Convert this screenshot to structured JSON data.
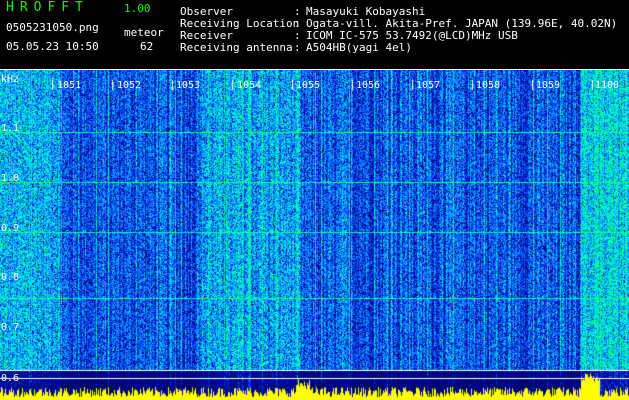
{
  "app": {
    "title": "HROFFT",
    "version": "1.00"
  },
  "left_info": {
    "filename": "0505231050.png",
    "meteor_label": "meteor",
    "datetime": "05.05.23 10:50",
    "meteor_count": "62"
  },
  "info": [
    {
      "label": "Observer",
      "sep": ":",
      "value": "Masayuki Kobayashi"
    },
    {
      "label": "Receiving Location",
      "sep": ":",
      "value": "Ogata-vill. Akita-Pref. JAPAN (139.96E, 40.02N)"
    },
    {
      "label": "Receiver",
      "sep": ":",
      "value": "ICOM IC-575 53.7492(@LCD)MHz USB"
    },
    {
      "label": "Receiving antenna",
      "sep": ":",
      "value": "A504HB(yagi 4el)"
    }
  ],
  "spectrogram": {
    "y_unit": "kHz",
    "y_ticks": [
      "1.1",
      "1.0",
      "0.9",
      "0.8",
      "0.7",
      "0.6"
    ],
    "x_ticks": [
      "1051",
      "1052",
      "1053",
      "1054",
      "1055",
      "1056",
      "1057",
      "1058",
      "1059",
      "1100"
    ],
    "colors": {
      "background": "#000000",
      "low": "#001a8c",
      "mid": "#1a5cff",
      "high": "#00ffcc",
      "peak": "#ffff00",
      "text": "#ffffff",
      "title": "#00ff00"
    }
  }
}
